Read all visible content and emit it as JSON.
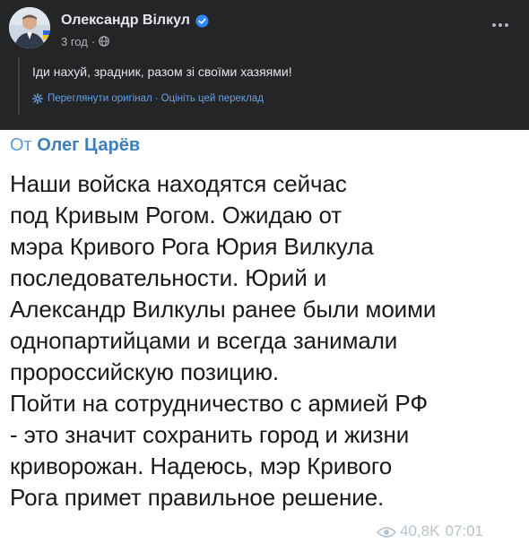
{
  "post": {
    "author": "Олександр Вілкул",
    "time": "3 год",
    "translated_text": "Іди нахуй, зрадник, разом зі своїми хазяями!",
    "links": {
      "view_original": "Переглянути оригінал",
      "separator": "·",
      "rate_translation": "Оцініть цей переклад"
    },
    "colors": {
      "background": "#242526",
      "text": "#e4e6eb",
      "secondary": "#b0b3b8",
      "link": "#6aa0e6",
      "verified": "#2d88ff"
    },
    "icons": [
      "verified-badge-icon",
      "globe-icon",
      "more-options-icon",
      "gear-icon"
    ]
  },
  "telegram": {
    "forward_prefix": "От",
    "forward_from": "Олег Царёв",
    "lines": [
      "Наши войска находятся сейчас",
      "под Кривым Рогом. Ожидаю от",
      "мэра Кривого Рога Юрия Вилкула",
      "последовательности. Юрий и",
      "Александр Вилкулы ранее были моими",
      "однопартийцами и всегда занимали",
      "пророссийскую позицию.",
      "Пойти на сотрудничество с армией РФ",
      "- это значит сохранить город и жизни",
      "криворожан. Надеюсь, мэр Кривого",
      "Рога примет правильное решение."
    ],
    "footer": {
      "views": "40,8K",
      "time": "07:01"
    },
    "colors": {
      "name": "#3d7fc2",
      "text": "#1a1a1a",
      "footer": "#b8c3cc"
    },
    "icons": [
      "eye-icon"
    ]
  }
}
